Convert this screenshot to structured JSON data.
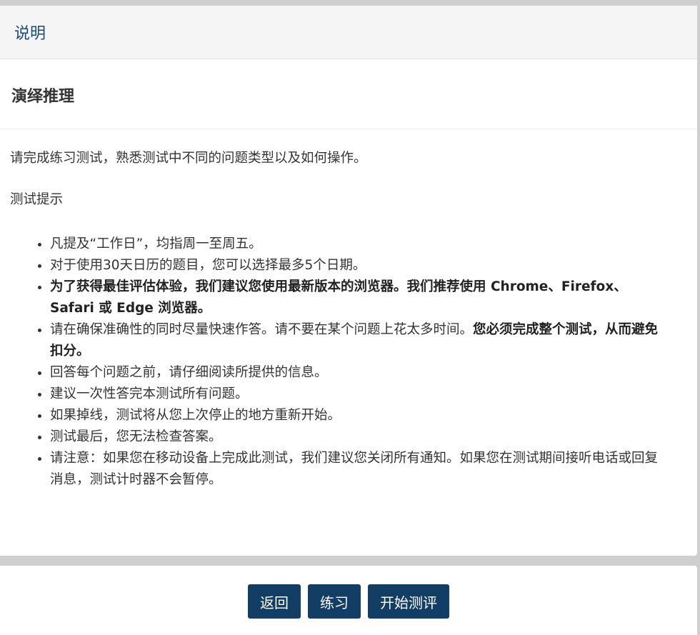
{
  "header": {
    "title": "说明"
  },
  "section": {
    "title": "演绎推理"
  },
  "intro": "请完成练习测试，熟悉测试中不同的问题类型以及如何操作。",
  "tips_heading": "测试提示",
  "tips": [
    "凡提及“工作日”，均指周一至周五。",
    "对于使用30天日历的题目，您可以选择最多5个日期。",
    "为了获得最佳评估体验，我们建议您使用最新版本的浏览器。我们推荐使用 Chrome、Firefox、Safari 或 Edge 浏览器。",
    "请在确保准确性的同时尽量快速作答。请不要在某个问题上花太多时间。",
    "您必须完成整个测试，从而避免扣分。",
    "回答每个问题之前，请仔细阅读所提供的信息。",
    "建议一次性答完本测试所有问题。",
    "如果掉线，测试将从您上次停止的地方重新开始。",
    "测试最后，您无法检查答案。",
    "请注意：如果您在移动设备上完成此测试，我们建议您关闭所有通知。如果您在测试期间接听电话或回复消息，测试计时器不会暂停。"
  ],
  "buttons": {
    "back": "返回",
    "practice": "练习",
    "start": "开始测评"
  },
  "colors": {
    "primary_button": "#123e66",
    "header_text": "#1a4a78"
  }
}
